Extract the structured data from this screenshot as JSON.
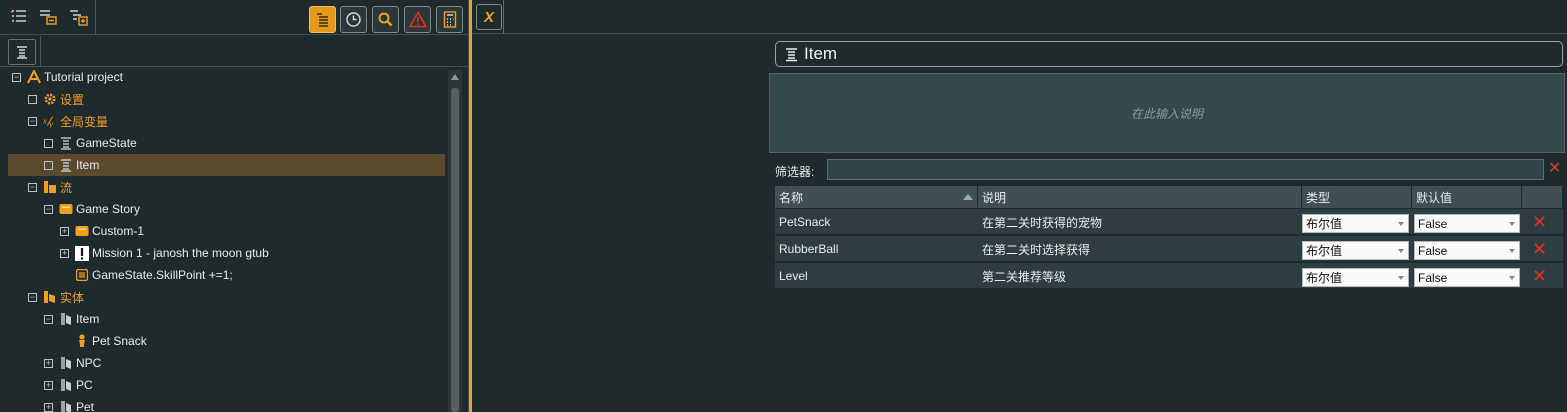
{
  "toolbar": {
    "left_icons": [
      "checklist-icon",
      "list-indent-icon",
      "tree-expand-icon"
    ],
    "right_buttons": [
      {
        "name": "outline-view-icon",
        "active": true
      },
      {
        "name": "clock-icon",
        "active": false
      },
      {
        "name": "search-icon",
        "active": false
      },
      {
        "name": "warning-icon",
        "active": false
      },
      {
        "name": "calculator-icon",
        "active": false
      }
    ]
  },
  "tree": {
    "items": [
      {
        "label": "Tutorial project",
        "indent": 0,
        "expander": "minus",
        "icon": "articy-logo-icon",
        "color": "white"
      },
      {
        "label": "设置",
        "indent": 1,
        "expander": "box",
        "icon": "gear-icon",
        "color": "orange"
      },
      {
        "label": "全局变量",
        "indent": 1,
        "expander": "minus",
        "icon": "variables-icon",
        "color": "orange"
      },
      {
        "label": "GameState",
        "indent": 2,
        "expander": "box",
        "icon": "variable-set-icon",
        "color": "white"
      },
      {
        "label": "Item",
        "indent": 2,
        "expander": "box",
        "icon": "variable-set-icon",
        "color": "white",
        "selected": true
      },
      {
        "label": "流",
        "indent": 1,
        "expander": "minus",
        "icon": "flow-folder-icon",
        "color": "orange"
      },
      {
        "label": "Game Story",
        "indent": 2,
        "expander": "minus",
        "icon": "flow-fragment-icon",
        "color": "white"
      },
      {
        "label": "Custom-1",
        "indent": 3,
        "expander": "plus",
        "icon": "flow-fragment-icon",
        "color": "white"
      },
      {
        "label": "Mission 1 - janosh the moon gtub",
        "indent": 3,
        "expander": "plus",
        "icon": "exclamation-icon",
        "color": "white"
      },
      {
        "label": "GameState.SkillPoint +=1;",
        "indent": 3,
        "expander": "none",
        "icon": "instruction-icon",
        "color": "white"
      },
      {
        "label": "实体",
        "indent": 1,
        "expander": "minus",
        "icon": "entities-folder-icon",
        "color": "orange"
      },
      {
        "label": "Item",
        "indent": 2,
        "expander": "minus",
        "icon": "template-folder-icon",
        "color": "white"
      },
      {
        "label": "Pet Snack",
        "indent": 3,
        "expander": "none",
        "icon": "entity-person-icon",
        "color": "white"
      },
      {
        "label": "NPC",
        "indent": 2,
        "expander": "plus",
        "icon": "template-folder-icon",
        "color": "white"
      },
      {
        "label": "PC",
        "indent": 2,
        "expander": "plus",
        "icon": "template-folder-icon",
        "color": "white"
      },
      {
        "label": "Pet",
        "indent": 2,
        "expander": "plus",
        "icon": "template-folder-icon",
        "color": "white"
      }
    ]
  },
  "editor": {
    "close_label": "X",
    "title": "Item",
    "description_placeholder": "在此输入说明",
    "filter_label": "筛选器:",
    "filter_value": "",
    "columns": [
      "名称",
      "说明",
      "类型",
      "默认值"
    ],
    "rows": [
      {
        "name": "PetSnack",
        "description": "在第二关时获得的宠物",
        "type": "布尔值",
        "default": "False"
      },
      {
        "name": "RubberBall",
        "description": "在第二关时选择获得",
        "type": "布尔值",
        "default": "False"
      },
      {
        "name": "Level",
        "description": "第二关推荐等级",
        "type": "布尔值",
        "default": "False"
      }
    ]
  },
  "colors": {
    "accent": "#e7a62a",
    "selected_row": "#5b4a2e",
    "delete": "#e0302a"
  }
}
